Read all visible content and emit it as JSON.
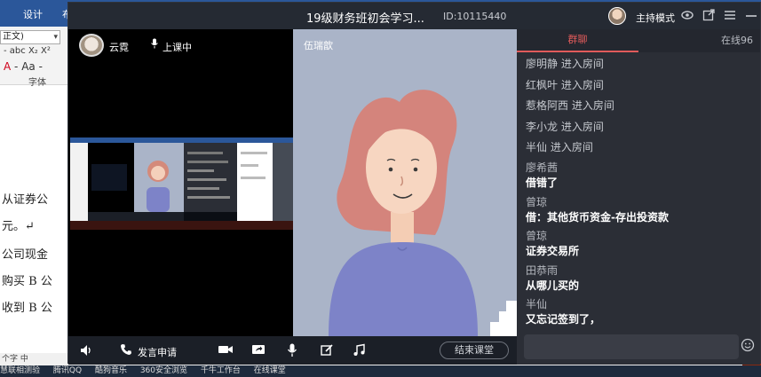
{
  "word": {
    "tabs": [
      "设计",
      "布"
    ],
    "font_name": "正文)",
    "ribbon_row1": "- abc X₂ X²",
    "ribbon_row2_a": "A",
    "ribbon_row2_b": "- Aa -",
    "group_label": "字体",
    "lines": [
      "从证券公",
      "元。↵",
      "公司现金",
      "购买 B 公",
      "收到 B 公"
    ],
    "status": "个字  中",
    "taskbar": [
      "慧联相测验",
      "腾讯QQ",
      "酷狗音乐",
      "360安全浏览",
      "千牛工作台",
      "在线课堂"
    ]
  },
  "window": {
    "title": "19级财务班初会学习...",
    "room_id": "ID:10115440",
    "host_mode": "主持模式"
  },
  "teacher": {
    "name": "云霓",
    "status": "上课中"
  },
  "student": {
    "name": "伍瑞歆"
  },
  "bottombar": {
    "raise_hand": "发言申请",
    "end_class": "结束课堂"
  },
  "chat": {
    "tab_group": "群聊",
    "tab_online": "在线96",
    "joins": [
      {
        "name": "廖明静",
        "action": "进入房间"
      },
      {
        "name": "红枫叶",
        "action": "  进入房间"
      },
      {
        "name": "惹格阿西",
        "action": "进入房间"
      },
      {
        "name": "李小龙",
        "action": "进入房间"
      },
      {
        "name": "半仙",
        "action": "进入房间"
      }
    ],
    "messages": [
      {
        "sender": "廖希茜",
        "text": "借错了"
      },
      {
        "sender": "曾琼",
        "text": "借：其他货币资金-存出投资款"
      },
      {
        "sender": "曾琼",
        "text": "证券交易所"
      },
      {
        "sender": "田恭雨",
        "text": "从哪儿买的"
      },
      {
        "sender": "半仙",
        "text": "又忘记签到了，"
      }
    ]
  },
  "colors": {
    "accent": "#e15b5b",
    "word_blue": "#2b579a",
    "panel": "#2b2e36"
  }
}
